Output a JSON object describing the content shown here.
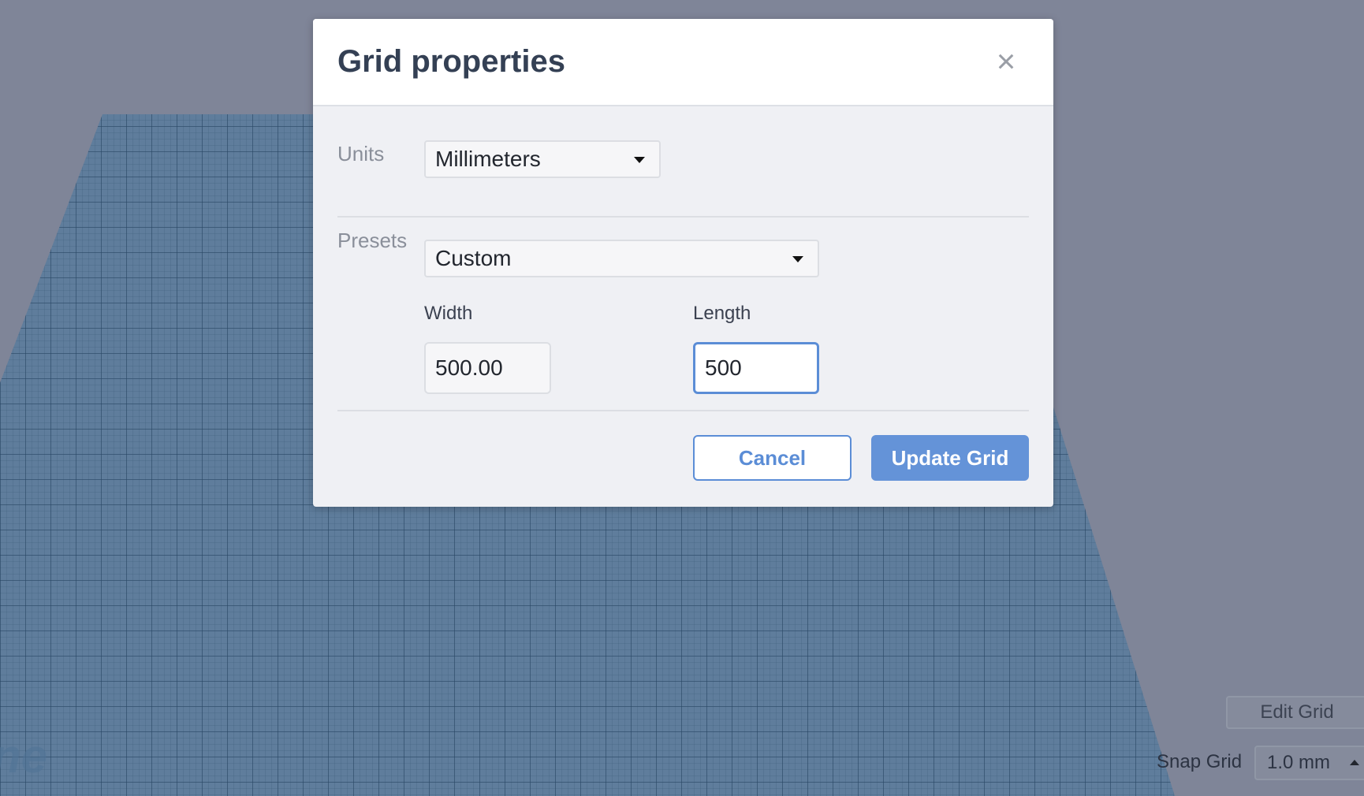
{
  "dialog": {
    "title": "Grid properties",
    "close_icon": "close-icon"
  },
  "units": {
    "label": "Units",
    "selected": "Millimeters"
  },
  "presets": {
    "label": "Presets",
    "selected": "Custom"
  },
  "width": {
    "label": "Width",
    "value": "500.00"
  },
  "length": {
    "label": "Length",
    "value": "500"
  },
  "buttons": {
    "cancel": "Cancel",
    "update": "Update Grid"
  },
  "workplane": {
    "edit_grid": "Edit Grid",
    "snap_label": "Snap Grid",
    "snap_value": "1.0 mm",
    "logo_text": "ne"
  },
  "colors": {
    "accent": "#5b8dd6",
    "primary_button": "#6493d8",
    "backdrop": "#7f8598"
  }
}
